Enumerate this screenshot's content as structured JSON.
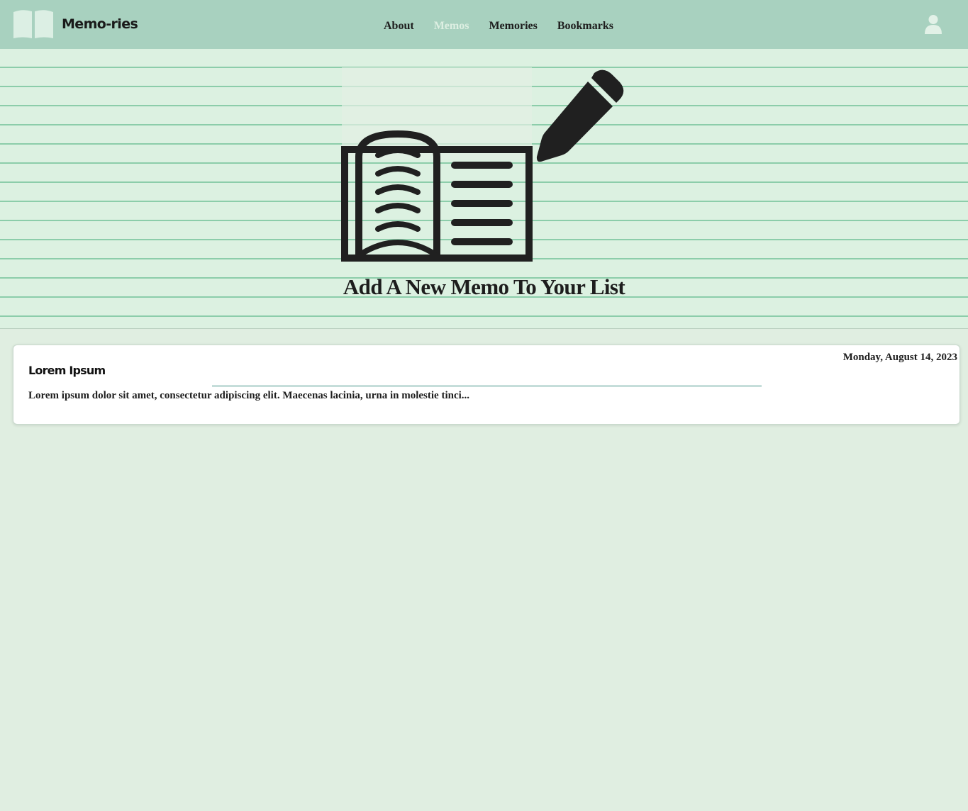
{
  "brand": {
    "name": "Memo-ries",
    "icon": "open-book-icon"
  },
  "nav": {
    "links": [
      {
        "label": "About",
        "active": false
      },
      {
        "label": "Memos",
        "active": true
      },
      {
        "label": "Memories",
        "active": false
      },
      {
        "label": "Bookmarks",
        "active": false
      }
    ],
    "user_icon": "user-icon"
  },
  "hero": {
    "title": "Add A New Memo To Your List",
    "icons": [
      "open-book-icon",
      "pencil-icon"
    ]
  },
  "memos": [
    {
      "date": "Monday, August 14, 2023",
      "title": "Lorem Ipsum",
      "excerpt": "Lorem ipsum dolor sit amet, consectetur adipiscing elit. Maecenas lacinia, urna in molestie tinci..."
    }
  ],
  "colors": {
    "header": "#a8d1bf",
    "page_background": "#e0eee1",
    "hero_background": "#dcf1e1",
    "hero_lines": "#8ccdaa",
    "active_link": "#ddefe2",
    "divider": "#3a8e82"
  }
}
